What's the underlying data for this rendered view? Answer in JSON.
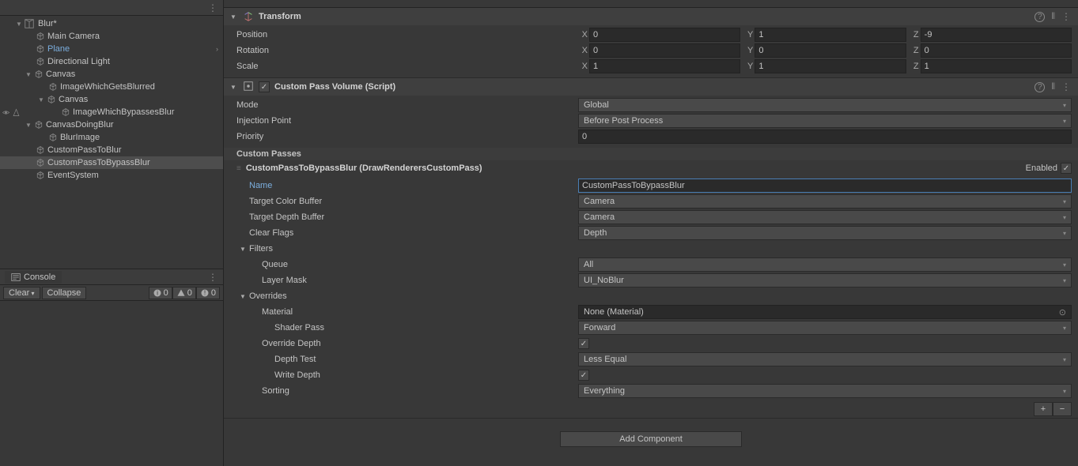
{
  "hierarchy": {
    "scene": "Blur*",
    "items": [
      {
        "label": "Main Camera",
        "indent": 1
      },
      {
        "label": "Plane",
        "indent": 1,
        "blue": true,
        "chevron": true
      },
      {
        "label": "Directional Light",
        "indent": 1
      },
      {
        "label": "Canvas",
        "indent": 1,
        "fold": "open"
      },
      {
        "label": "ImageWhichGetsBlurred",
        "indent": 2
      },
      {
        "label": "Canvas",
        "indent": 2,
        "fold": "open"
      },
      {
        "label": "ImageWhichBypassesBlur",
        "indent": 3,
        "eyes": true
      },
      {
        "label": "CanvasDoingBlur",
        "indent": 1,
        "fold": "open"
      },
      {
        "label": "BlurImage",
        "indent": 2
      },
      {
        "label": "CustomPassToBlur",
        "indent": 1
      },
      {
        "label": "CustomPassToBypassBlur",
        "indent": 1,
        "selected": true
      },
      {
        "label": "EventSystem",
        "indent": 1
      }
    ]
  },
  "console": {
    "tab": "Console",
    "clear": "Clear",
    "collapse": "Collapse",
    "info": "0",
    "warn": "0",
    "error": "0"
  },
  "transform": {
    "title": "Transform",
    "position": {
      "label": "Position",
      "x": "0",
      "y": "1",
      "z": "-9"
    },
    "rotation": {
      "label": "Rotation",
      "x": "0",
      "y": "0",
      "z": "0"
    },
    "scale": {
      "label": "Scale",
      "x": "1",
      "y": "1",
      "z": "1"
    }
  },
  "customPassVolume": {
    "title": "Custom Pass Volume (Script)",
    "mode": {
      "label": "Mode",
      "value": "Global"
    },
    "injection": {
      "label": "Injection Point",
      "value": "Before Post Process"
    },
    "priority": {
      "label": "Priority",
      "value": "0"
    },
    "passesLabel": "Custom Passes",
    "pass": {
      "title": "CustomPassToBypassBlur (DrawRenderersCustomPass)",
      "enabledLabel": "Enabled",
      "name": {
        "label": "Name",
        "value": "CustomPassToBypassBlur"
      },
      "targetColor": {
        "label": "Target Color Buffer",
        "value": "Camera"
      },
      "targetDepth": {
        "label": "Target Depth Buffer",
        "value": "Camera"
      },
      "clearFlags": {
        "label": "Clear Flags",
        "value": "Depth"
      },
      "filtersLabel": "Filters",
      "queue": {
        "label": "Queue",
        "value": "All"
      },
      "layerMask": {
        "label": "Layer Mask",
        "value": "UI_NoBlur"
      },
      "overridesLabel": "Overrides",
      "material": {
        "label": "Material",
        "value": "None (Material)"
      },
      "shaderPass": {
        "label": "Shader Pass",
        "value": "Forward"
      },
      "overrideDepth": {
        "label": "Override Depth"
      },
      "depthTest": {
        "label": "Depth Test",
        "value": "Less Equal"
      },
      "writeDepth": {
        "label": "Write Depth"
      },
      "sorting": {
        "label": "Sorting",
        "value": "Everything"
      }
    }
  },
  "addComponent": "Add Component"
}
